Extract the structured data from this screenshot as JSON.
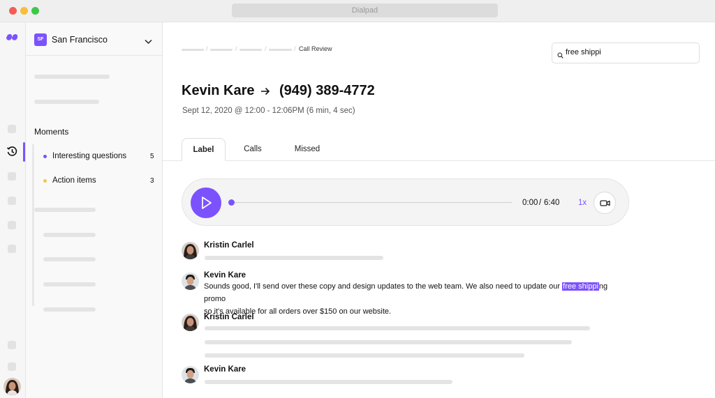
{
  "window": {
    "title": "Dialpad"
  },
  "office": {
    "badge": "SF",
    "name": "San Francisco"
  },
  "moments": {
    "label": "Moments",
    "items": [
      {
        "label": "Interesting questions",
        "count": "5",
        "color": "#7c52ff"
      },
      {
        "label": "Action items",
        "count": "3",
        "color": "#f6c54a"
      }
    ]
  },
  "breadcrumb": {
    "current": "Call Review"
  },
  "search": {
    "value": "free shippi",
    "placeholder": ""
  },
  "call": {
    "caller": "Kevin Kare",
    "number": "(949) 389-4772",
    "time": "Sept 12, 2020 @ 12:00 - 12:06PM (6 min, 4 sec)"
  },
  "tabs": [
    {
      "label": "Label"
    },
    {
      "label": "Calls"
    },
    {
      "label": "Missed"
    }
  ],
  "player": {
    "current": "0:00",
    "separator": "/",
    "total": "6:40",
    "speed": "1x"
  },
  "transcript": [
    {
      "speaker": "Kristin Carlel"
    },
    {
      "speaker": "Kevin Kare",
      "text_before": "Sounds good, I'll send over these copy and design updates to the web team. We also need to update our ",
      "highlight": "free shippi",
      "text_after_line1": "ng promo",
      "text_line2": "so it's available for all orders over $150 on our website."
    },
    {
      "speaker": "Kristin Carlel"
    },
    {
      "speaker": "Kevin Kare"
    }
  ],
  "colors": {
    "accent": "#7c52ff",
    "action_dot": "#f6c54a"
  }
}
